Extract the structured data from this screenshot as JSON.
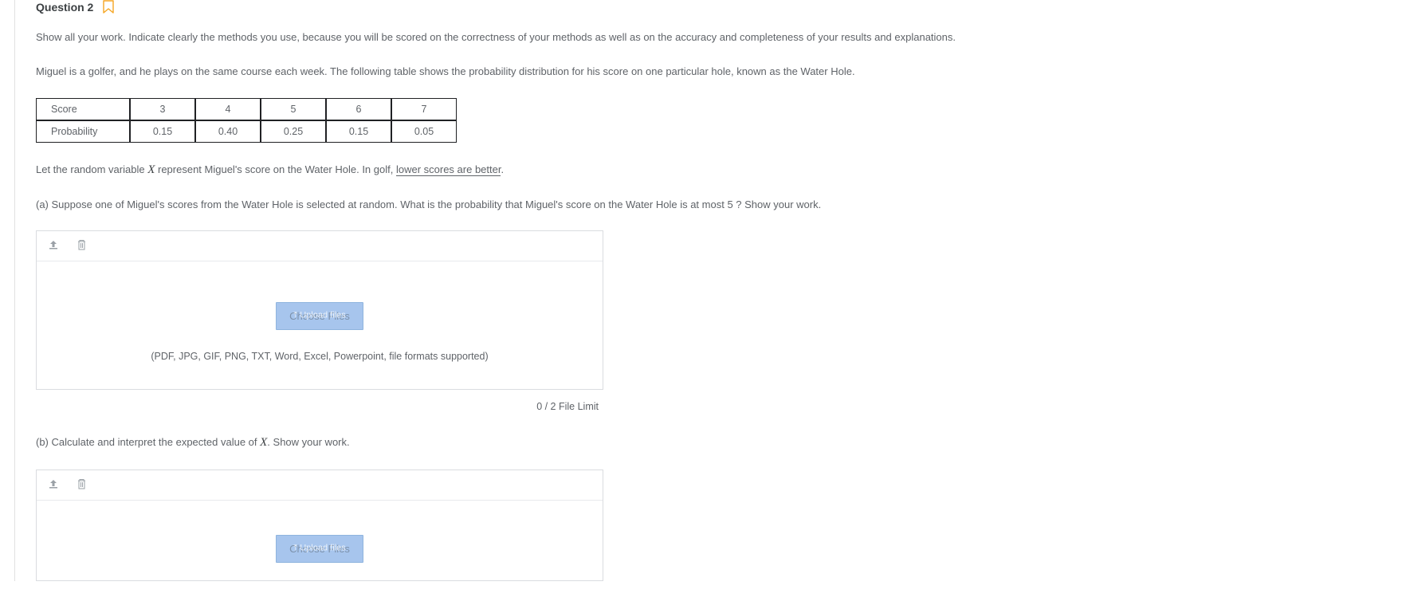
{
  "question": {
    "title": "Question 2",
    "instructions": "Show all your work. Indicate clearly the methods you use, because you will be scored on the correctness of your methods as well as on the accuracy and completeness of your results and explanations.",
    "context": "Miguel is a golfer, and he plays on the same course each week. The following table shows the probability distribution for his score on one particular hole, known as the Water Hole.",
    "table": {
      "row1_head": "Score",
      "row1": [
        "3",
        "4",
        "5",
        "6",
        "7"
      ],
      "row2_head": "Probability",
      "row2": [
        "0.15",
        "0.40",
        "0.25",
        "0.15",
        "0.05"
      ]
    },
    "let_pre": "Let the random variable ",
    "let_mid": " represent Miguel's score on the Water Hole. In golf, ",
    "let_underlined": "lower scores are better",
    "let_post": ".",
    "part_a": "(a) Suppose one of Miguel's scores from the Water Hole is selected at random. What is the probability that Miguel's score on the Water Hole is at most 5 ? Show your work.",
    "part_b_pre": "(b) Calculate and interpret the expected value of ",
    "part_b_post": ". Show your work."
  },
  "upload": {
    "choose_label": "Choose Files",
    "ghost_label": "Upload files",
    "formats": "(PDF, JPG, GIF, PNG, TXT, Word, Excel, Powerpoint, file formats supported)",
    "limit": "0 / 2 File Limit"
  }
}
